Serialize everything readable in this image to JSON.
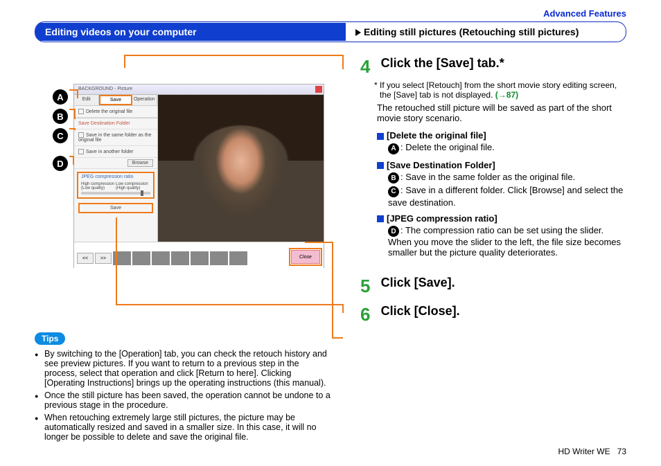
{
  "header": {
    "section": "Advanced Features",
    "left_title": "Editing videos on your computer",
    "right_title": "Editing still pictures (Retouching still pictures)"
  },
  "callouts": [
    "A",
    "B",
    "C",
    "D"
  ],
  "screenshot": {
    "window_title": "BACKGROUND - Picture",
    "tabs": {
      "edit": "Edit",
      "save": "Save",
      "operation": "Operation"
    },
    "rows": {
      "delete": "Delete the original file",
      "dest_header": "Save Destination Folder",
      "same_folder": "Save in the same folder as the original file",
      "other_folder": "Save in another folder",
      "browse": "Browse",
      "jpeg_header": "JPEG compression ratio",
      "slider_left": "High compression (Low quality)",
      "slider_right": "Low compression (High quality)",
      "save_btn": "Save"
    },
    "strip": {
      "prev": "<<",
      "next": ">>",
      "close": "Close"
    }
  },
  "steps": {
    "s4": {
      "num": "4",
      "title": "Click the [Save] tab.",
      "star": "*",
      "note": "* If you select [Retouch] from the short movie story editing screen, the [Save] tab is not displayed.",
      "link": "(→87)",
      "body": "The retouched still picture will be saved as part of the short movie story scenario.",
      "opt1_h": "[Delete the original file]",
      "opt1_b": ": Delete the original file.",
      "opt2_h": "[Save Destination Folder]",
      "opt2_b1": ": Save in the same folder as the original file.",
      "opt2_b2": ": Save in a different folder. Click [Browse] and select the save destination.",
      "opt3_h": "[JPEG compression ratio]",
      "opt3_b": ": The compression ratio can be set using the slider. When you move the slider to the left, the file size becomes smaller but the picture quality deteriorates."
    },
    "s5": {
      "num": "5",
      "title": "Click [Save]."
    },
    "s6": {
      "num": "6",
      "title": "Click [Close]."
    }
  },
  "tips": {
    "label": "Tips",
    "items": [
      "By switching to the [Operation] tab, you can check the retouch history and see preview pictures. If you want to return to a previous step in the process, select that operation and click [Return to here]. Clicking [Operating Instructions] brings up the operating instructions (this manual).",
      "Once the still picture has been saved, the operation cannot be undone to a previous stage in the procedure.",
      "When retouching extremely large still pictures, the picture may be automatically resized and saved in a smaller size. In this case, it will no longer be possible to delete and save the original file."
    ]
  },
  "footer": {
    "product": "HD Writer WE",
    "page": "73"
  }
}
